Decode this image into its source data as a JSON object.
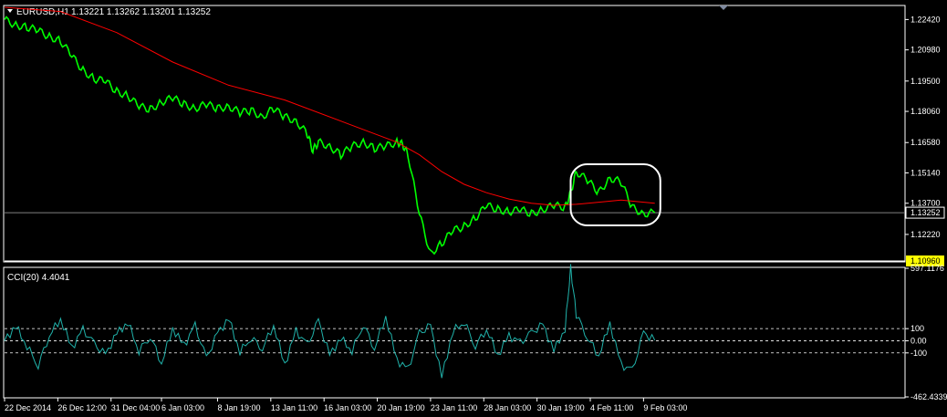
{
  "header": {
    "symbol": "EURUSD,H1",
    "quote": "1.13221 1.13262 1.13201 1.13252"
  },
  "indicator_header": "CCI(20) 4.4041",
  "colors": {
    "background": "#000000",
    "frame": "#ffffff",
    "price": "#00ff00",
    "moving_average": "#ff0000",
    "cci": "#20b2aa",
    "current_price_line": "#808080",
    "highlight": "#ffff00",
    "annotation": "#ffffff"
  },
  "chart_data": [
    {
      "type": "line",
      "panel": "price",
      "ylim": [
        1.1096,
        1.23
      ],
      "y_ticks": [
        1.2242,
        1.2098,
        1.195,
        1.1806,
        1.1658,
        1.1514,
        1.137,
        1.1222
      ],
      "y_tick_labels": [
        "1.22420",
        "1.20980",
        "1.19500",
        "1.18060",
        "1.16580",
        "1.15140",
        "1.13700",
        "1.12220"
      ],
      "current_price": 1.13252,
      "current_price_label": "1.13252",
      "low_marker": 1.1096,
      "low_marker_label": "1.10960",
      "x_labels": [
        "22 Dec 2014",
        "26 Dec 12:00",
        "31 Dec 04:00",
        "6 Jan 03:00",
        "8 Jan 19:00",
        "13 Jan 11:00",
        "16 Jan 03:00",
        "20 Jan 19:00",
        "23 Jan 11:00",
        "28 Jan 03:00",
        "30 Jan 19:00",
        "4 Feb 11:00",
        "9 Feb 03:00"
      ],
      "x_label_pos": [
        0,
        9.5,
        19,
        28,
        38,
        47.5,
        57,
        66.5,
        76,
        85.5,
        95,
        104.5,
        114
      ],
      "x_range": [
        0,
        130
      ],
      "series": [
        {
          "role": "price",
          "x": [
            0,
            2,
            4,
            6,
            8,
            10,
            12,
            14,
            16,
            18,
            20,
            22,
            24,
            26,
            28,
            30,
            32,
            34,
            36,
            38,
            40,
            42,
            44,
            46,
            48,
            50,
            52,
            54,
            55,
            56,
            58,
            60,
            62,
            64,
            66,
            68,
            70,
            71,
            72,
            74,
            76,
            78,
            80,
            82,
            84,
            86,
            88,
            90,
            92,
            94,
            96,
            98,
            100,
            101,
            102,
            104,
            106,
            108,
            110,
            112,
            114,
            116
          ],
          "y": [
            1.2242,
            1.2215,
            1.2205,
            1.219,
            1.216,
            1.214,
            1.207,
            1.2,
            1.196,
            1.195,
            1.19,
            1.188,
            1.183,
            1.1815,
            1.185,
            1.187,
            1.184,
            1.182,
            1.184,
            1.182,
            1.183,
            1.18,
            1.181,
            1.178,
            1.182,
            1.178,
            1.176,
            1.17,
            1.162,
            1.166,
            1.164,
            1.16,
            1.164,
            1.166,
            1.163,
            1.164,
            1.166,
            1.165,
            1.16,
            1.132,
            1.113,
            1.118,
            1.124,
            1.126,
            1.13,
            1.136,
            1.134,
            1.133,
            1.134,
            1.132,
            1.134,
            1.136,
            1.135,
            1.142,
            1.152,
            1.148,
            1.142,
            1.149,
            1.147,
            1.135,
            1.132,
            1.1325
          ]
        },
        {
          "role": "moving_average",
          "x": [
            0,
            10,
            20,
            30,
            40,
            50,
            60,
            70,
            74,
            78,
            82,
            86,
            90,
            94,
            98,
            102,
            106,
            110,
            116
          ],
          "y": [
            1.23,
            1.228,
            1.218,
            1.204,
            1.193,
            1.186,
            1.176,
            1.166,
            1.16,
            1.152,
            1.146,
            1.142,
            1.139,
            1.137,
            1.136,
            1.1365,
            1.1375,
            1.1385,
            1.137
          ]
        }
      ],
      "annotation": {
        "shape": "rounded-rectangle",
        "x_range": [
          101,
          117
        ],
        "y_range": [
          1.1265,
          1.1555
        ]
      }
    },
    {
      "type": "line",
      "panel": "cci",
      "title": "CCI(20) 4.4041",
      "ylim": [
        -462.4339,
        597.1176
      ],
      "y_ticks": [
        597.1176,
        100,
        0,
        -100,
        -462.4339
      ],
      "y_tick_labels": [
        "597.1176",
        "100",
        "0.00",
        "-100",
        "-462.4339"
      ],
      "levels": [
        100,
        -100
      ],
      "last_value": 4.4041,
      "series": [
        {
          "role": "cci",
          "x": [
            0,
            2,
            4,
            6,
            8,
            10,
            12,
            14,
            16,
            18,
            20,
            22,
            24,
            26,
            28,
            30,
            32,
            34,
            36,
            38,
            40,
            42,
            44,
            46,
            48,
            50,
            52,
            54,
            56,
            58,
            60,
            62,
            64,
            66,
            68,
            70,
            72,
            74,
            76,
            78,
            80,
            82,
            84,
            86,
            88,
            90,
            92,
            94,
            96,
            98,
            100,
            101,
            102,
            104,
            106,
            108,
            110,
            112,
            114,
            116
          ],
          "y": [
            0,
            120,
            -40,
            -200,
            50,
            180,
            -60,
            90,
            -30,
            -120,
            60,
            150,
            -80,
            40,
            -180,
            100,
            -40,
            120,
            -150,
            60,
            180,
            -90,
            30,
            -60,
            130,
            -200,
            80,
            -40,
            160,
            -120,
            20,
            -80,
            140,
            -60,
            200,
            -160,
            -240,
            60,
            120,
            -300,
            80,
            160,
            -40,
            100,
            -120,
            40,
            -20,
            60,
            130,
            -80,
            100,
            597,
            220,
            30,
            -120,
            140,
            -200,
            -250,
            60,
            4.4
          ]
        }
      ]
    }
  ]
}
